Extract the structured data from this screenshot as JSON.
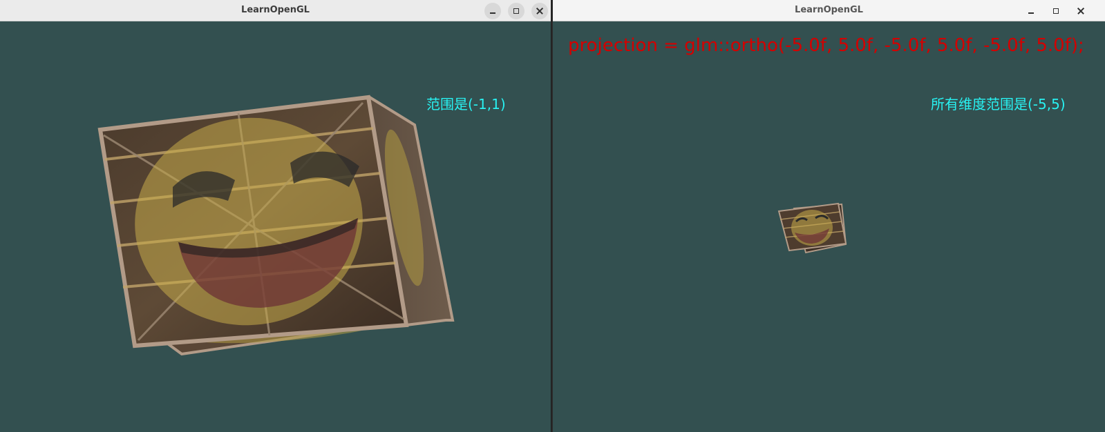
{
  "windows": [
    {
      "title": "LearnOpenGL",
      "controls": {
        "minimize": "minimize-icon",
        "maximize": "maximize-icon",
        "close": "close-icon"
      },
      "range_label": "范围是(-1,1)"
    },
    {
      "title": "LearnOpenGL",
      "controls": {
        "minimize": "minimize-icon",
        "maximize": "maximize-icon",
        "close": "close-icon"
      },
      "code_label": "projection = glm::ortho(-5.0f, 5.0f, -5.0f, 5.0f, -5.0f, 5.0f);",
      "range_label": "所有维度范围是(-5,5)"
    }
  ],
  "colors": {
    "clear_color": "#335050",
    "range_text": "#28f2f2",
    "code_text": "#d40000"
  }
}
